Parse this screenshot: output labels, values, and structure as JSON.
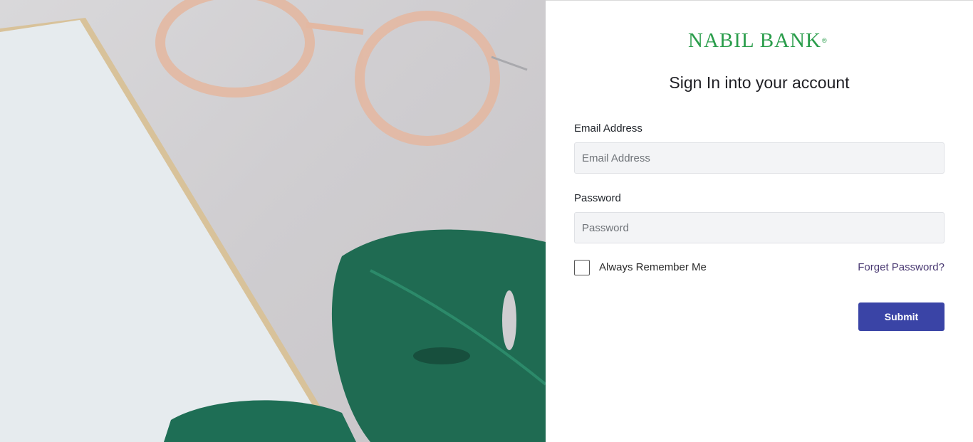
{
  "brand": {
    "name": "NABIL BANK",
    "registered_mark": "®",
    "color": "#2a9d4b"
  },
  "form": {
    "title": "Sign In into your account",
    "email": {
      "label": "Email Address",
      "placeholder": "Email Address",
      "value": ""
    },
    "password": {
      "label": "Password",
      "placeholder": "Password",
      "value": ""
    },
    "remember": {
      "label": "Always Remember Me",
      "checked": false
    },
    "forgot_label": "Forget Password?",
    "submit_label": "Submit",
    "accent_color": "#3a44a6"
  },
  "hero": {
    "description_icon": "photo-illustration"
  }
}
